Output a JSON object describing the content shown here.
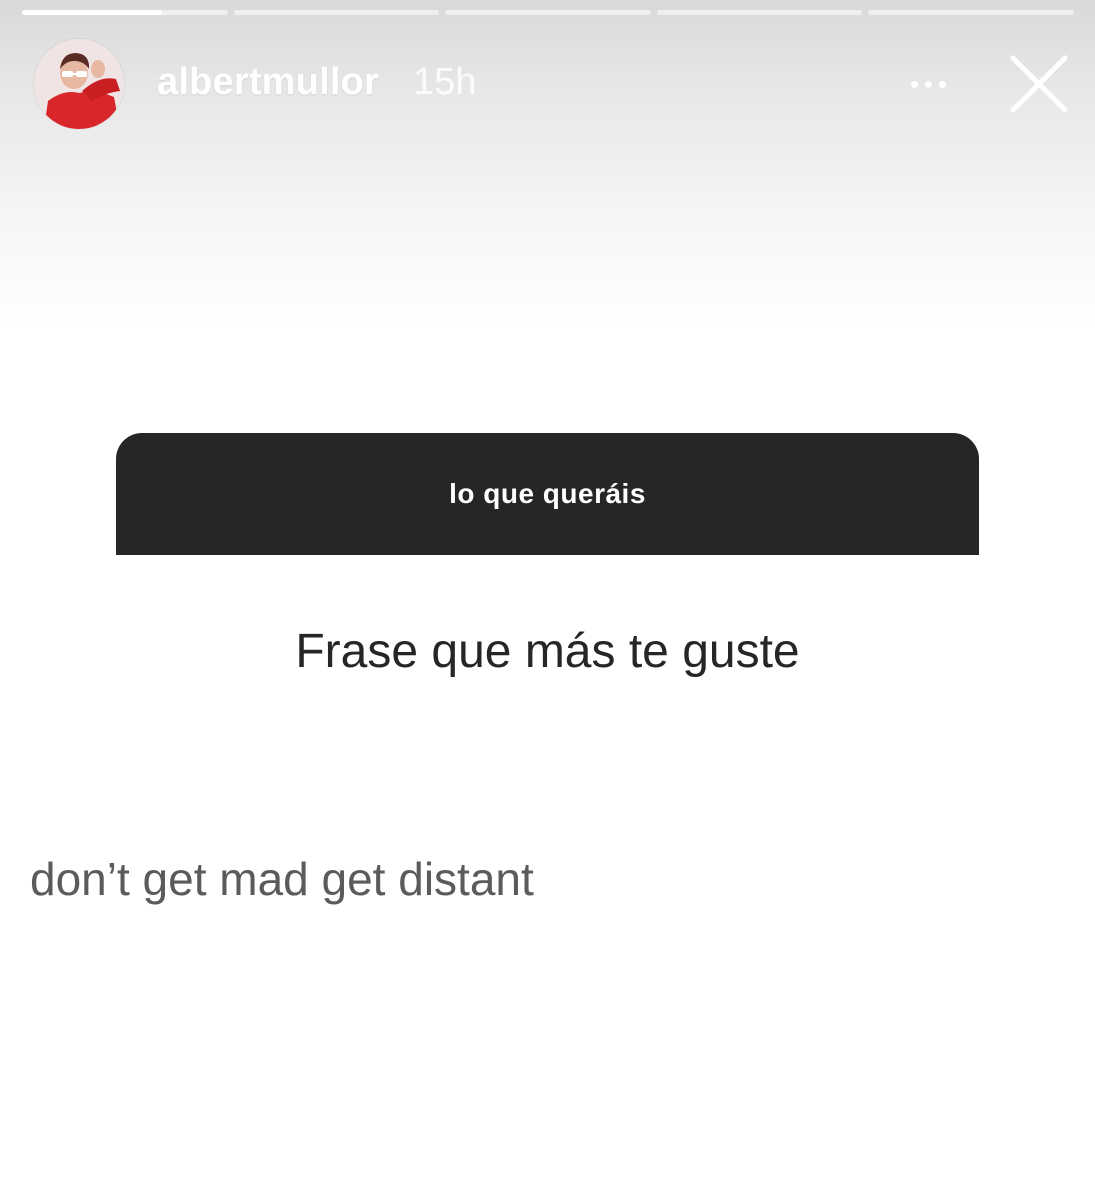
{
  "story": {
    "progress": [
      1,
      0,
      0,
      0,
      0
    ],
    "current_progress": 0.68
  },
  "header": {
    "username": "albertmullor",
    "timestamp": "15h",
    "more_icon": "more-dots-icon",
    "close_icon": "close-icon"
  },
  "question_sticker": {
    "prompt": "lo que queráis",
    "response": "Frase que más te guste"
  },
  "overlay_text": "don’t get mad get distant",
  "colors": {
    "card_background": "#262626",
    "avatar_accent": "#d9262a"
  }
}
